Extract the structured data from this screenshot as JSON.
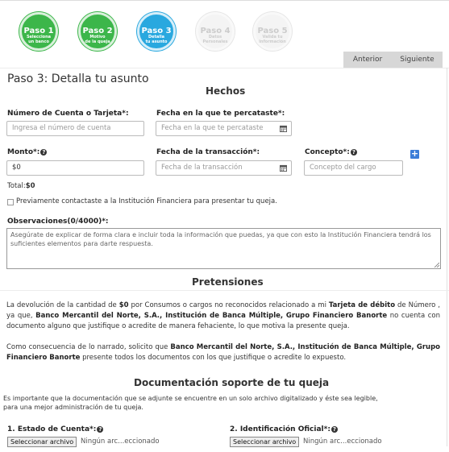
{
  "steps": [
    {
      "title": "Paso 1",
      "sub1": "Selecciona",
      "sub2": "un banco"
    },
    {
      "title": "Paso 2",
      "sub1": "Motivo",
      "sub2": "de la queja"
    },
    {
      "title": "Paso 3",
      "sub1": "Detalla",
      "sub2": "tu asunto"
    },
    {
      "title": "Paso 4",
      "sub1": "Datos",
      "sub2": "Personales"
    },
    {
      "title": "Paso 5",
      "sub1": "Valida tu",
      "sub2": "información"
    }
  ],
  "nav": {
    "prev": "Anterior",
    "next": "Siguiente"
  },
  "page_title": "Paso 3: Detalla tu asunto",
  "hechos": {
    "heading": "Hechos",
    "account_label": "Número de Cuenta o Tarjeta*:",
    "account_placeholder": "Ingresa el número de cuenta",
    "noticed_label": "Fecha en la que te percataste*:",
    "noticed_placeholder": "Fecha en la que te percataste",
    "amount_label": "Monto*:",
    "amount_value": "$0",
    "transaction_label": "Fecha de la transacción*:",
    "transaction_placeholder": "Fecha de la transacción",
    "concept_label": "Concepto*:",
    "concept_placeholder": "Concepto del cargo",
    "total_label": "Total:",
    "total_value": "$0",
    "prev_contact": "Previamente contactaste a la Institución Financiera para presentar tu queja.",
    "obs_label": "Observaciones(0/4000)*:",
    "obs_placeholder": "Asegúrate de explicar de forma clara e incluir toda la información que puedas, ya que con esto la Institución Financiera tendrá los suficientes elementos para darte respuesta."
  },
  "pretensiones": {
    "heading": "Pretensiones",
    "p1_a": "La devolución de la cantidad de ",
    "p1_amount": "$0",
    "p1_b": " por Consumos o cargos no reconocidos relacionado a mi ",
    "p1_product": "Tarjeta de débito",
    "p1_c": " de Número , ya que, ",
    "p1_bank": "Banco Mercantil del Norte, S.A., Institución de Banca Múltiple, Grupo Financiero Banorte",
    "p1_d": " no cuenta con documento alguno que justifique o acredite de manera fehaciente, lo que motiva la presente queja.",
    "p2_a": "Como consecuencia de lo narrado, solicito que ",
    "p2_bank": "Banco Mercantil del Norte, S.A., Institución de Banca Múltiple, Grupo Financiero Banorte",
    "p2_b": " presente todos los documentos con los que justifique o acredite lo expuesto."
  },
  "docs": {
    "heading": "Documentación soporte de tu queja",
    "note": "Es importante que la documentación que se adjunte se encuentre en un solo archivo digitalizado y éste sea legible, para una mejor administración de tu queja.",
    "doc1_label": "1. Estado de Cuenta*:",
    "doc2_label": "2. Identificación Oficial*:",
    "file_button": "Seleccionar archivo",
    "file_none": "Ningún arc...eccionado"
  },
  "colors": {
    "done": "#3cb64a",
    "current": "#29a8df",
    "pending": "#f4f4f4",
    "plus": "#3b7dd8"
  }
}
